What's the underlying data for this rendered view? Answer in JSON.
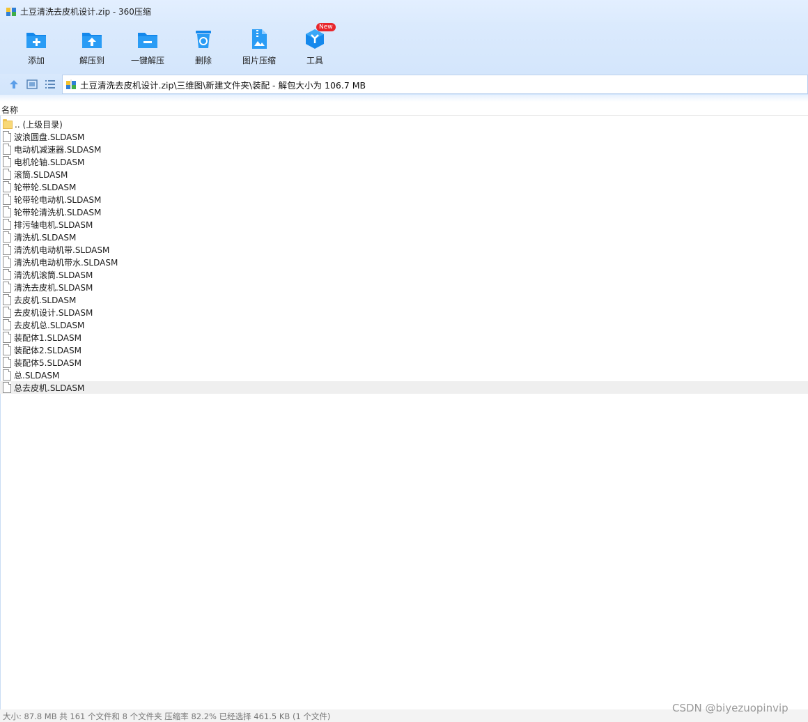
{
  "window": {
    "title": "土豆清洗去皮机设计.zip - 360压缩"
  },
  "toolbar": {
    "items": [
      {
        "label": "添加",
        "icon": "add-folder-icon"
      },
      {
        "label": "解压到",
        "icon": "extract-folder-icon"
      },
      {
        "label": "一键解压",
        "icon": "one-click-extract-icon"
      },
      {
        "label": "删除",
        "icon": "recycle-bin-icon"
      },
      {
        "label": "图片压缩",
        "icon": "image-compress-icon"
      },
      {
        "label": "工具",
        "icon": "tools-cube-icon"
      }
    ],
    "new_badge": "New"
  },
  "address": {
    "path": "土豆清洗去皮机设计.zip\\三维图\\新建文件夹\\装配 - 解包大小为 106.7 MB"
  },
  "list": {
    "column_name": "名称",
    "parent_dir": ".. (上级目录)",
    "files": [
      "波浪圆盘.SLDASM",
      "电动机减速器.SLDASM",
      "电机轮轴.SLDASM",
      "滚筒.SLDASM",
      "轮带轮.SLDASM",
      "轮带轮电动机.SLDASM",
      "轮带轮清洗机.SLDASM",
      "排污轴电机.SLDASM",
      "清洗机.SLDASM",
      "清洗机电动机带.SLDASM",
      "清洗机电动机带水.SLDASM",
      "清洗机滚筒.SLDASM",
      "清洗去皮机.SLDASM",
      "去皮机.SLDASM",
      "去皮机设计.SLDASM",
      "去皮机总.SLDASM",
      "装配体1.SLDASM",
      "装配体2.SLDASM",
      "装配体5.SLDASM",
      "总.SLDASM",
      "总去皮机.SLDASM"
    ],
    "selected_index": 20
  },
  "status": {
    "text": "大小: 87.8 MB 共 161 个文件和 8 个文件夹 压缩率 82.2% 已经选择 461.5 KB (1 个文件)"
  },
  "watermark": "CSDN @biyezuopinvip",
  "colors": {
    "accent": "#1a8cf0",
    "toolbar_bg": "#d6e7fc",
    "badge": "#e8262c",
    "selected_row": "#efefef"
  }
}
